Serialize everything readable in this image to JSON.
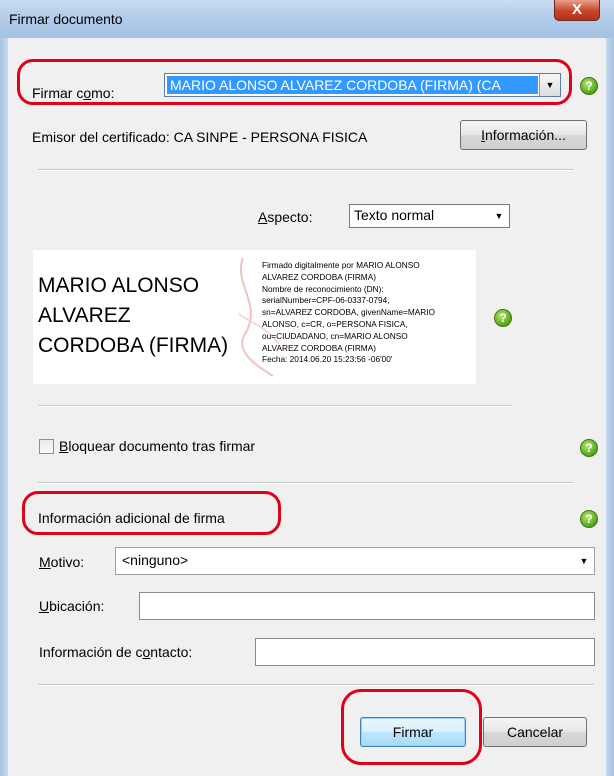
{
  "window": {
    "title": "Firmar documento",
    "close_glyph": "X"
  },
  "sign_as": {
    "label_pre": "Firmar c",
    "label_key": "o",
    "label_post": "mo:",
    "value": "MARIO ALONSO ALVAREZ CORDOBA (FIRMA) (CA"
  },
  "issuer": {
    "text": "Emisor del certificado: CA SINPE - PERSONA FISICA"
  },
  "info_button": {
    "key": "I",
    "rest": "nformación..."
  },
  "appearance": {
    "label_key": "A",
    "label_rest": "specto:",
    "value": "Texto normal"
  },
  "signature_preview": {
    "name_lines": [
      "MARIO ALONSO",
      "ALVAREZ",
      "CORDOBA (FIRMA)"
    ],
    "detail_lines": [
      "Firmado digitalmente por MARIO ALONSO",
      "ALVAREZ CORDOBA (FIRMA)",
      "Nombre de reconocimiento (DN):",
      "serialNumber=CPF-06-0337-0794,",
      "sn=ALVAREZ CORDOBA, givenName=MARIO",
      "ALONSO, c=CR, o=PERSONA FISICA,",
      "ou=CIUDADANO, cn=MARIO ALONSO",
      "ALVAREZ CORDOBA (FIRMA)",
      "Fecha: 2014.06.20 15:23:56 -06'00'"
    ]
  },
  "lock_doc": {
    "label_key": "B",
    "label_rest": "loquear documento tras firmar",
    "checked": false
  },
  "additional": {
    "title": "Información adicional de firma"
  },
  "reason": {
    "label_key": "M",
    "label_rest": "otivo:",
    "value": "<ninguno>"
  },
  "location": {
    "label_key": "U",
    "label_rest": "bicación:",
    "value": ""
  },
  "contact": {
    "label_pre": "Información de c",
    "label_key": "o",
    "label_post": "ntacto:",
    "value": ""
  },
  "buttons": {
    "sign": "Firmar",
    "cancel": "Cancelar"
  },
  "help_glyph": "?",
  "colors": {
    "highlight": "#e1001a",
    "selection": "#3399ff",
    "help": "#53a31c"
  }
}
